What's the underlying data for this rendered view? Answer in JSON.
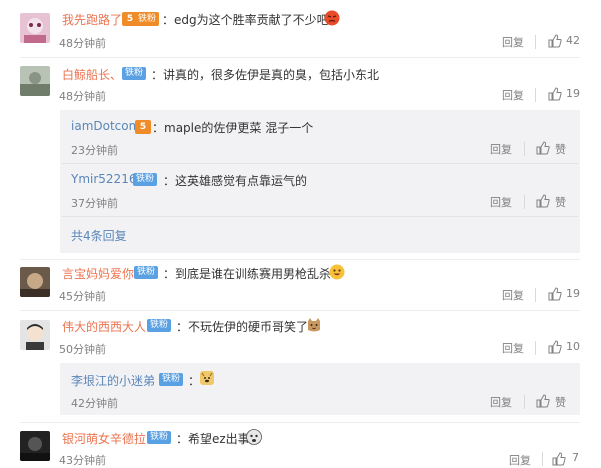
{
  "labels": {
    "reply": "回复",
    "fan_badge": "铁粉",
    "vip_level": "5"
  },
  "comments": [
    {
      "username": "我先跑路了",
      "text": "：edg为这个胜率贡献了不少吧",
      "time": "48分钟前",
      "likes": "42",
      "emoji": "angry-face"
    },
    {
      "username": "白鲸船长、",
      "text": "：讲真的，很多佐伊是真的臭，包括小东北",
      "time": "48分钟前",
      "likes": "19"
    },
    {
      "username": "言宝妈妈爱你",
      "text": "：到底是谁在训练赛用男枪乱杀",
      "time": "45分钟前",
      "likes": "19",
      "emoji": "grin-face"
    },
    {
      "username": "伟大的西西大人",
      "text": "：不玩佐伊的硬币哥笑了",
      "time": "50分钟前",
      "likes": "10",
      "emoji": "cat-face"
    },
    {
      "username": "银河萌女辛德拉",
      "text": "：希望ez出事",
      "time": "43分钟前",
      "likes": "7",
      "emoji": "scared-face"
    }
  ],
  "replies_block_1": {
    "items": [
      {
        "username": "iamDotcom",
        "text": "：maple的佐伊更菜 混子一个",
        "time": "23分钟前",
        "like_label": "赞"
      },
      {
        "username": "Ymir52216",
        "text": "：这英雄感觉有点靠运气的",
        "time": "37分钟前",
        "like_label": "赞"
      }
    ],
    "more_label": "共4条回复"
  },
  "replies_block_2": {
    "items": [
      {
        "username": "李垠江的小迷弟",
        "text": "：",
        "time": "42分钟前",
        "like_label": "赞",
        "emoji": "doge-face"
      }
    ]
  },
  "colors": {
    "username": "#eb7350",
    "reply_username": "#5a86b8",
    "badge": "#5aa1e3",
    "vip_badge": "#f08c28",
    "reply_bg": "#f2f2f5"
  }
}
